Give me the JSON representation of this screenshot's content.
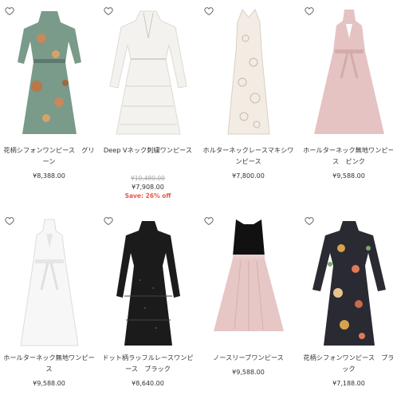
{
  "icons": {
    "wishlist": "heart-outline-icon"
  },
  "colors": {
    "sale": "#f0534b",
    "strike": "#aaaaaa",
    "text": "#333333"
  },
  "products": [
    {
      "name": "花柄シフォンワンピース　グリーン",
      "price": "¥8,388.00"
    },
    {
      "name": "Deep Vネック刺繍ワンピース",
      "original_price": "¥10,480.00",
      "price": "¥7,908.00",
      "save": "Save: 26% off"
    },
    {
      "name": "ホルターネックレースマキシワンピース",
      "price": "¥7,800.00"
    },
    {
      "name": "ホールターネック無地ワンピース　ピンク",
      "price": "¥9,588.00"
    },
    {
      "name": "ホールターネック無地ワンピース",
      "price": "¥9,588.00"
    },
    {
      "name": "ドット柄ラッフルレースワンピース　ブラック",
      "price": "¥8,640.00"
    },
    {
      "name": "ノースリーブワンピース",
      "price": "¥9,588.00"
    },
    {
      "name": "花柄シフォンワンピース　ブラック",
      "price": "¥7,188.00"
    }
  ]
}
